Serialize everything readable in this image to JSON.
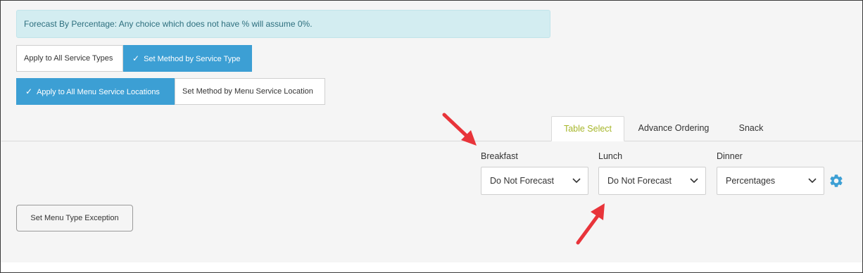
{
  "banner": {
    "text": "Forecast By Percentage: Any choice which does not have % will assume 0%."
  },
  "service_type_group": {
    "options": [
      {
        "label": "Apply to All Service Types",
        "active": false
      },
      {
        "label": "Set Method by Service Type",
        "active": true
      }
    ]
  },
  "location_group": {
    "options": [
      {
        "label": "Apply to All Menu Service Locations",
        "active": true
      },
      {
        "label": "Set Method by Menu Service Location",
        "active": false
      }
    ]
  },
  "tabs": [
    {
      "label": "Table Select",
      "active": true
    },
    {
      "label": "Advance Ordering",
      "active": false
    },
    {
      "label": "Snack",
      "active": false
    }
  ],
  "meals": [
    {
      "label": "Breakfast",
      "value": "Do Not Forecast"
    },
    {
      "label": "Lunch",
      "value": "Do Not Forecast"
    },
    {
      "label": "Dinner",
      "value": "Percentages"
    }
  ],
  "exception_button": {
    "label": "Set Menu Type Exception"
  },
  "icons": {
    "check": "check-icon",
    "chevron": "chevron-down-icon",
    "settings": "gear-icon",
    "annotation": "arrow-icon"
  },
  "colors": {
    "accent_blue": "#3c9fd4",
    "banner_bg": "#d3edf1",
    "banner_text": "#2d6f7e",
    "active_tab_text": "#a6b629",
    "annotation_red": "#e8343a"
  }
}
